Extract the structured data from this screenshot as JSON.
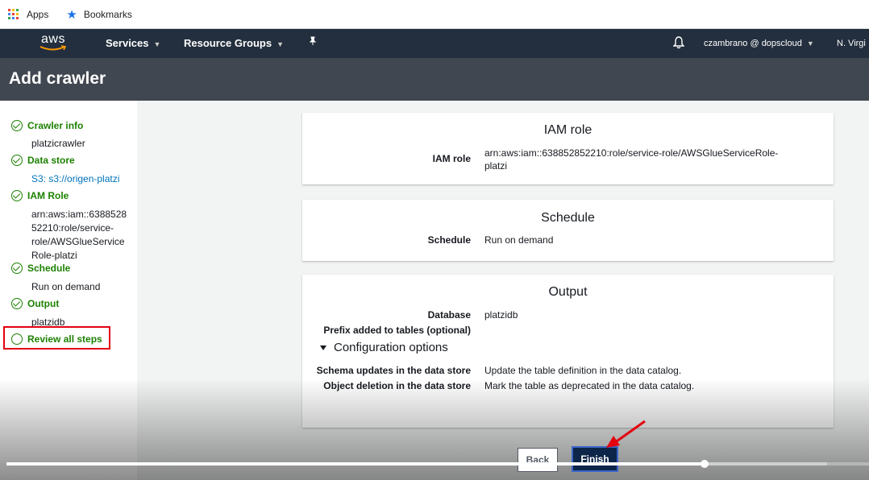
{
  "bookmarks_bar": {
    "apps_label": "Apps",
    "bookmarks_label": "Bookmarks"
  },
  "aws_nav": {
    "logo_text": "aws",
    "services_label": "Services",
    "resource_groups_label": "Resource Groups",
    "user_label": "czambrano @ dopscloud",
    "region_label": "N. Virgi"
  },
  "page": {
    "title": "Add crawler"
  },
  "steps": [
    {
      "label": "Crawler info",
      "detail": "platzicrawler",
      "status": "complete"
    },
    {
      "label": "Data store",
      "detail": "S3: s3://origen-platzi",
      "status": "complete"
    },
    {
      "label": "IAM Role",
      "detail": "arn:aws:iam::638852852210:role/service-role/AWSGlueServiceRole-platzi",
      "detail_lines": [
        "arn:aws:iam::6388528",
        "52210:role/service-",
        "role/AWSGlueService",
        "Role-platzi"
      ],
      "status": "complete"
    },
    {
      "label": "Schedule",
      "detail": "Run on demand",
      "status": "complete"
    },
    {
      "label": "Output",
      "detail": "platzidb",
      "status": "complete"
    },
    {
      "label": "Review all steps",
      "status": "current"
    }
  ],
  "iam_card": {
    "title": "IAM role",
    "label": "IAM role",
    "value_lines": [
      "arn:aws:iam::638852852210:role/service-role/AWSGlueServiceRole-",
      "platzi"
    ]
  },
  "schedule_card": {
    "title": "Schedule",
    "label": "Schedule",
    "value": "Run on demand"
  },
  "output_card": {
    "title": "Output",
    "database_label": "Database",
    "database_value": "platzidb",
    "prefix_label": "Prefix added to tables (optional)",
    "prefix_value": "",
    "config_toggle": "Configuration options",
    "schema_label": "Schema updates in the data store",
    "schema_value": "Update the table definition in the data catalog.",
    "deletion_label": "Object deletion in the data store",
    "deletion_value": "Mark the table as deprecated in the data catalog."
  },
  "actions": {
    "back_label": "Back",
    "finish_label": "Finish"
  },
  "video_progress": {
    "played_fraction": 0.81
  },
  "colors": {
    "aws_nav_bg": "#232f3e",
    "title_bar_bg": "#414750",
    "step_complete": "#1d8102",
    "highlight_box": "#e3000f",
    "link": "#0073bb"
  }
}
